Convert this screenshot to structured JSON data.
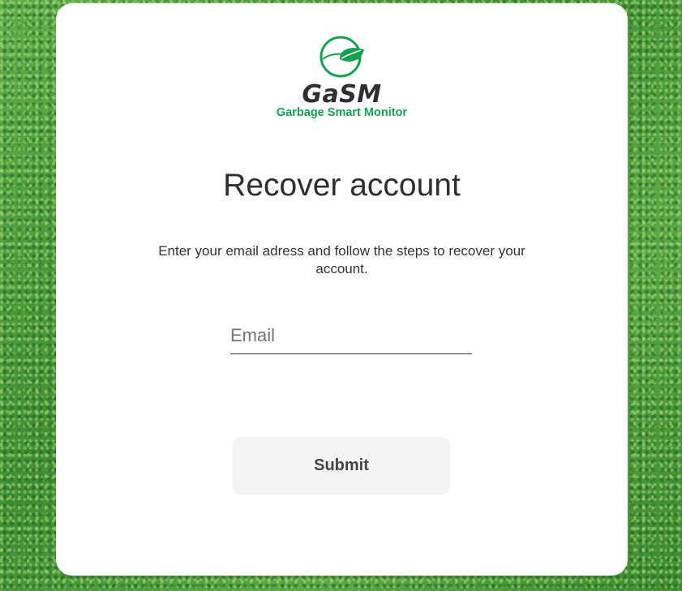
{
  "brand": {
    "name": "GaSM",
    "tagline": "Garbage Smart Monitor",
    "logo_icon": "leaf-icon",
    "accent_color": "#14a150"
  },
  "recover": {
    "title": "Recover account",
    "instructions": "Enter your email adress and follow the steps to recover your account.",
    "email_placeholder": "Email",
    "email_value": "",
    "submit_label": "Submit"
  },
  "background": {
    "style": "grass",
    "color": "#4a9a3c"
  }
}
